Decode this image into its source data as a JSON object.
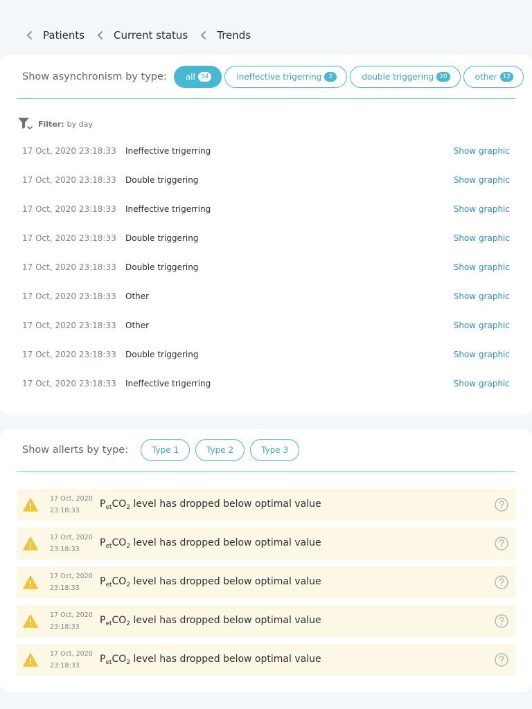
{
  "breadcrumb": [
    {
      "label": "Patients"
    },
    {
      "label": "Current status"
    },
    {
      "label": "Trends"
    }
  ],
  "asynchronism": {
    "title": "Show asynchronism by type:",
    "types": [
      {
        "label": "all",
        "count": "34",
        "active": true
      },
      {
        "label": "ineffective trigerring",
        "count": "2",
        "active": false
      },
      {
        "label": "double triggering",
        "count": "20",
        "active": false
      },
      {
        "label": "other",
        "count": "12",
        "active": false
      }
    ],
    "filter": {
      "key": "Filter:",
      "value": "by day"
    },
    "show_label": "Show graphic",
    "events": [
      {
        "timestamp": "17 Oct, 2020 23:18:33",
        "type": "Ineffective trigerring"
      },
      {
        "timestamp": "17 Oct, 2020 23:18:33",
        "type": "Double triggering"
      },
      {
        "timestamp": "17 Oct, 2020 23:18:33",
        "type": "Ineffective trigerring"
      },
      {
        "timestamp": "17 Oct, 2020 23:18:33",
        "type": "Double triggering"
      },
      {
        "timestamp": "17 Oct, 2020 23:18:33",
        "type": "Double triggering"
      },
      {
        "timestamp": "17 Oct, 2020 23:18:33",
        "type": "Other"
      },
      {
        "timestamp": "17 Oct, 2020 23:18:33",
        "type": "Other"
      },
      {
        "timestamp": "17 Oct, 2020 23:18:33",
        "type": "Double triggering"
      },
      {
        "timestamp": "17 Oct, 2020 23:18:33",
        "type": "Ineffective trigerring"
      }
    ]
  },
  "alerts": {
    "title": "Show allerts by type:",
    "types": [
      {
        "label": "Type 1"
      },
      {
        "label": "Type 2"
      },
      {
        "label": "Type 3"
      }
    ],
    "items": [
      {
        "date": "17 Oct, 2020",
        "time": "23:18:33",
        "msg_p": "P",
        "msg_sub1": "et",
        "msg_co": "CO",
        "msg_sub2": "2",
        "msg_rest": " level has dropped below optimal value"
      },
      {
        "date": "17 Oct, 2020",
        "time": "23:18:33",
        "msg_p": "P",
        "msg_sub1": "et",
        "msg_co": "CO",
        "msg_sub2": "2",
        "msg_rest": " level has dropped below optimal value"
      },
      {
        "date": "17 Oct, 2020",
        "time": "23:18:33",
        "msg_p": "P",
        "msg_sub1": "et",
        "msg_co": "CO",
        "msg_sub2": "2",
        "msg_rest": " level has dropped below optimal value"
      },
      {
        "date": "17 Oct, 2020",
        "time": "23:18:33",
        "msg_p": "P",
        "msg_sub1": "et",
        "msg_co": "CO",
        "msg_sub2": "2",
        "msg_rest": " level has dropped below optimal value"
      },
      {
        "date": "17 Oct, 2020",
        "time": "23:18:33",
        "msg_p": "P",
        "msg_sub1": "et",
        "msg_co": "CO",
        "msg_sub2": "2",
        "msg_rest": " level has dropped below optimal value"
      }
    ]
  },
  "colors": {
    "accent": "#47b8d4",
    "link": "#2f8fd8",
    "alert_bg": "#fdf8e6",
    "warning": "#f0c531"
  },
  "icons": {
    "back": "chevron-left-icon",
    "filter": "filter-icon",
    "warning": "warning-icon",
    "help": "help-circle-icon"
  }
}
